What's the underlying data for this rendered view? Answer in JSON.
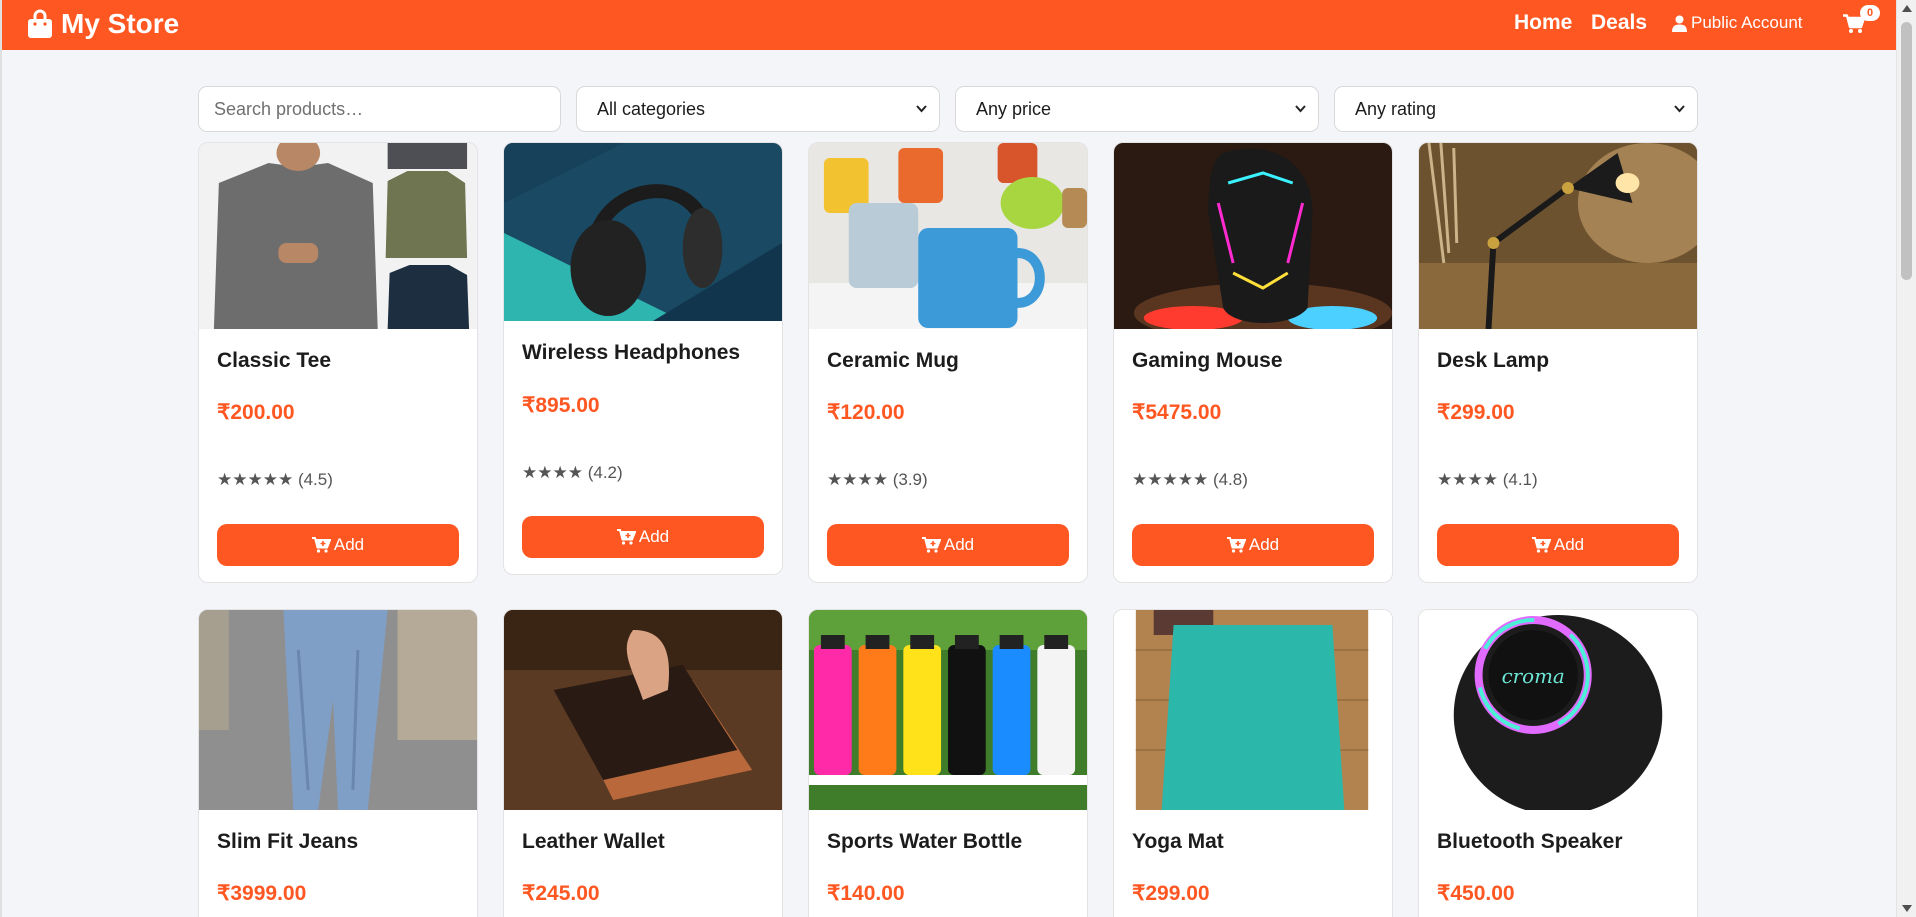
{
  "nav": {
    "brand": "My Store",
    "home": "Home",
    "deals": "Deals",
    "account": "Public Account",
    "cart_count": "0"
  },
  "filters": {
    "search_placeholder": "Search products…",
    "category": "All categories",
    "price": "Any price",
    "rating": "Any rating"
  },
  "add_label": "Add",
  "colors": {
    "accent": "#ff5722",
    "background": "#f4f5f9"
  },
  "products": [
    {
      "name": "Classic Tee",
      "price": "₹200.00",
      "stars": "★★★★★",
      "rating": "(4.5)"
    },
    {
      "name": "Wireless Headphones",
      "price": "₹895.00",
      "stars": "★★★★",
      "rating": "(4.2)"
    },
    {
      "name": "Ceramic Mug",
      "price": "₹120.00",
      "stars": "★★★★",
      "rating": "(3.9)"
    },
    {
      "name": "Gaming Mouse",
      "price": "₹5475.00",
      "stars": "★★★★★",
      "rating": "(4.8)"
    },
    {
      "name": "Desk Lamp",
      "price": "₹299.00",
      "stars": "★★★★",
      "rating": "(4.1)"
    },
    {
      "name": "Slim Fit Jeans",
      "price": "₹3999.00"
    },
    {
      "name": "Leather Wallet",
      "price": "₹245.00"
    },
    {
      "name": "Sports Water Bottle",
      "price": "₹140.00"
    },
    {
      "name": "Yoga Mat",
      "price": "₹299.00"
    },
    {
      "name": "Bluetooth Speaker",
      "price": "₹450.00"
    }
  ],
  "speaker_logo": "croma"
}
